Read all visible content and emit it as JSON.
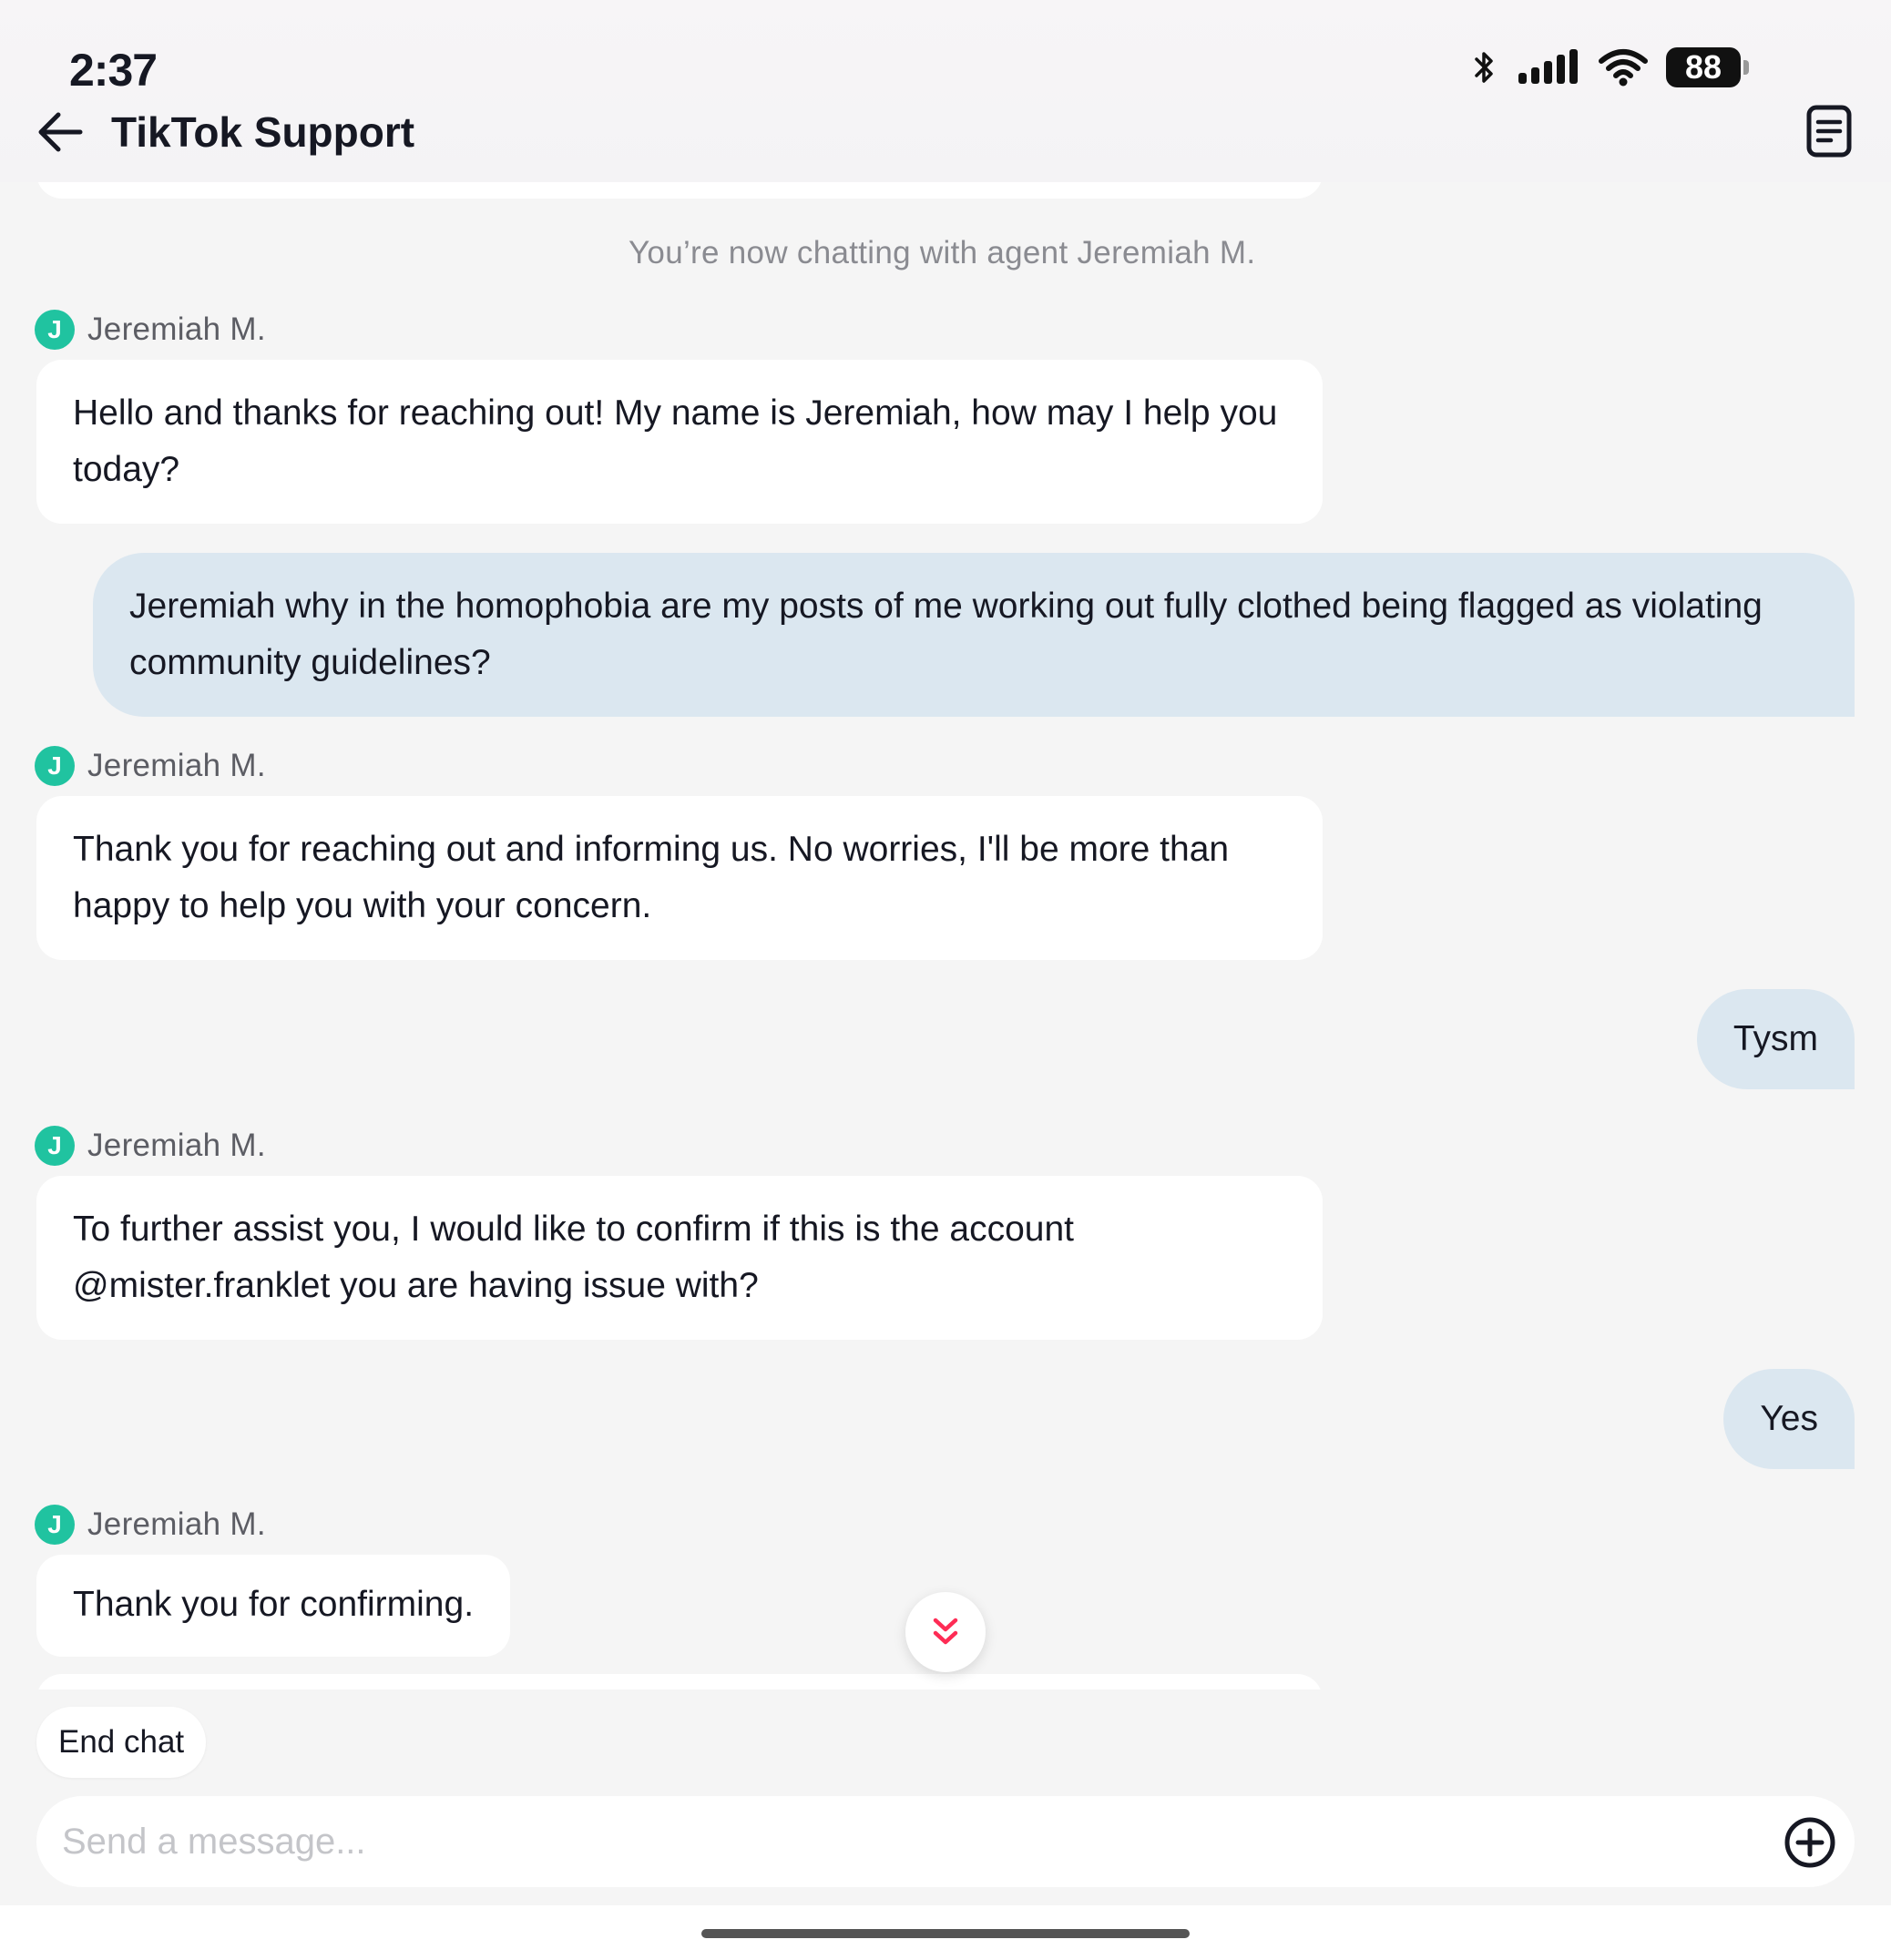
{
  "status_bar": {
    "time": "2:37",
    "battery": "88"
  },
  "header": {
    "title": "TikTok Support"
  },
  "chat": {
    "system_message": "You’re now chatting with agent Jeremiah M.",
    "messages": [
      {
        "sender": "agent",
        "name": "Jeremiah M.",
        "avatar_initial": "J",
        "text": "Hello and thanks for reaching out! My name is Jeremiah, how may I help you today?"
      },
      {
        "sender": "user",
        "text": "Jeremiah why in the homophobia are my posts of me working out fully clothed being flagged as violating community guidelines?"
      },
      {
        "sender": "agent",
        "name": "Jeremiah M.",
        "avatar_initial": "J",
        "text": "Thank you for reaching out and informing us. No worries, I'll be more than happy to help you with your concern."
      },
      {
        "sender": "user",
        "text": "Tysm"
      },
      {
        "sender": "agent",
        "name": "Jeremiah M.",
        "avatar_initial": "J",
        "text": "To further assist you, I would like to confirm if this is the account @mister.franklet you are having issue with?"
      },
      {
        "sender": "user",
        "text": "Yes"
      },
      {
        "sender": "agent",
        "name": "Jeremiah M.",
        "avatar_initial": "J",
        "text": "Thank you for confirming."
      }
    ]
  },
  "actions": {
    "end_chat": "End chat"
  },
  "composer": {
    "placeholder": "Send a message..."
  },
  "colors": {
    "avatar": "#20c3a0",
    "user_bubble": "#dbe7f0",
    "scroll_chevron": "#fe2c55"
  }
}
